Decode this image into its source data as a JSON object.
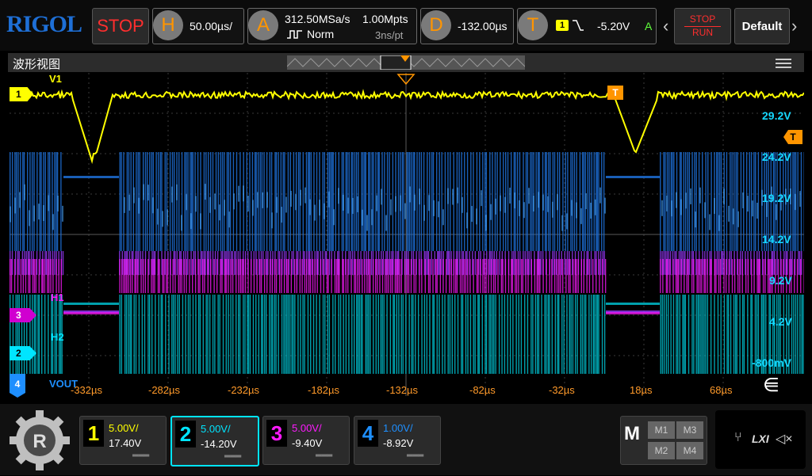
{
  "brand": "RIGOL",
  "run_state": "STOP",
  "horizontal": {
    "letter": "H",
    "scale": "50.00µs/"
  },
  "acquire": {
    "letter": "A",
    "sample_rate": "312.50MSa/s",
    "mode": "Norm",
    "depth": "1.00Mpts",
    "resolution": "3ns/pt"
  },
  "delay": {
    "letter": "D",
    "value": "-132.00µs"
  },
  "trigger": {
    "letter": "T",
    "source": "1",
    "level": "-5.20V",
    "coupling": "A"
  },
  "right_buttons": {
    "stop": "STOP",
    "run": "RUN",
    "default": "Default"
  },
  "window_title": "波形视图",
  "time_ticks": [
    "-332µs",
    "-282µs",
    "-232µs",
    "-182µs",
    "-132µs",
    "-82µs",
    "-32µs",
    "18µs",
    "68µs"
  ],
  "voltage_labels": [
    "29.2V",
    "24.2V",
    "19.2V",
    "14.2V",
    "9.2V",
    "4.2V",
    "-800mV"
  ],
  "trace_labels": {
    "v1": "V1",
    "h1": "H1",
    "h2": "H2",
    "vout": "VOUT"
  },
  "trigger_marker": "T",
  "channel_markers": [
    "1",
    "3",
    "2",
    "4"
  ],
  "channels": [
    {
      "num": "1",
      "scale": "5.00V/",
      "offset": "17.40V",
      "color": "#ffff00"
    },
    {
      "num": "2",
      "scale": "5.00V/",
      "offset": "-14.20V",
      "color": "#00e5ff"
    },
    {
      "num": "3",
      "scale": "5.00V/",
      "offset": "-9.40V",
      "color": "#ff1aff"
    },
    {
      "num": "4",
      "scale": "1.00V/",
      "offset": "-8.92V",
      "color": "#1e8fff"
    }
  ],
  "math": {
    "label": "M",
    "items": [
      "M1",
      "M3",
      "M2",
      "M4"
    ]
  },
  "status": {
    "lxi": "LXI"
  },
  "colors": {
    "accent": "#ff9500",
    "ch1": "#ffff00",
    "ch2": "#00e5ff",
    "ch3": "#ff1aff",
    "ch4": "#1e8fff"
  }
}
